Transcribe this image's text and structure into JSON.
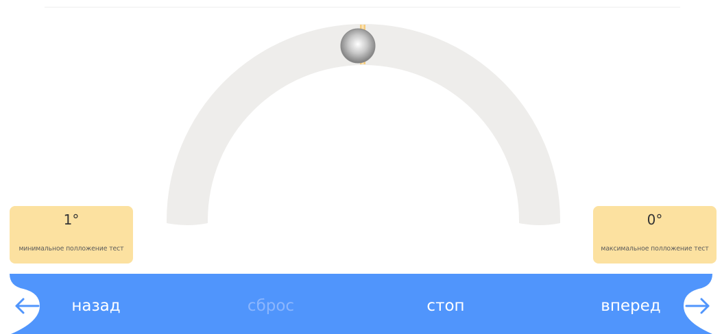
{
  "colors": {
    "track": "#eeedeb",
    "handle_marker": "#f7c66a",
    "limit_box": "#fce1a0",
    "control_bar": "#5095fc",
    "control_text": "#ffffff",
    "control_text_disabled": "#8cb6fd"
  },
  "gauge": {
    "position_fraction": 0.5
  },
  "limits": {
    "min": {
      "value": "1°",
      "label": "минимальное полложение тест"
    },
    "max": {
      "value": "0°",
      "label": "максимальное полложение тест"
    }
  },
  "controls": {
    "back_label": "назад",
    "reset_label": "сброс",
    "stop_label": "стоп",
    "forward_label": "вперед",
    "back_icon": "arrow-left-icon",
    "forward_icon": "arrow-right-icon"
  }
}
